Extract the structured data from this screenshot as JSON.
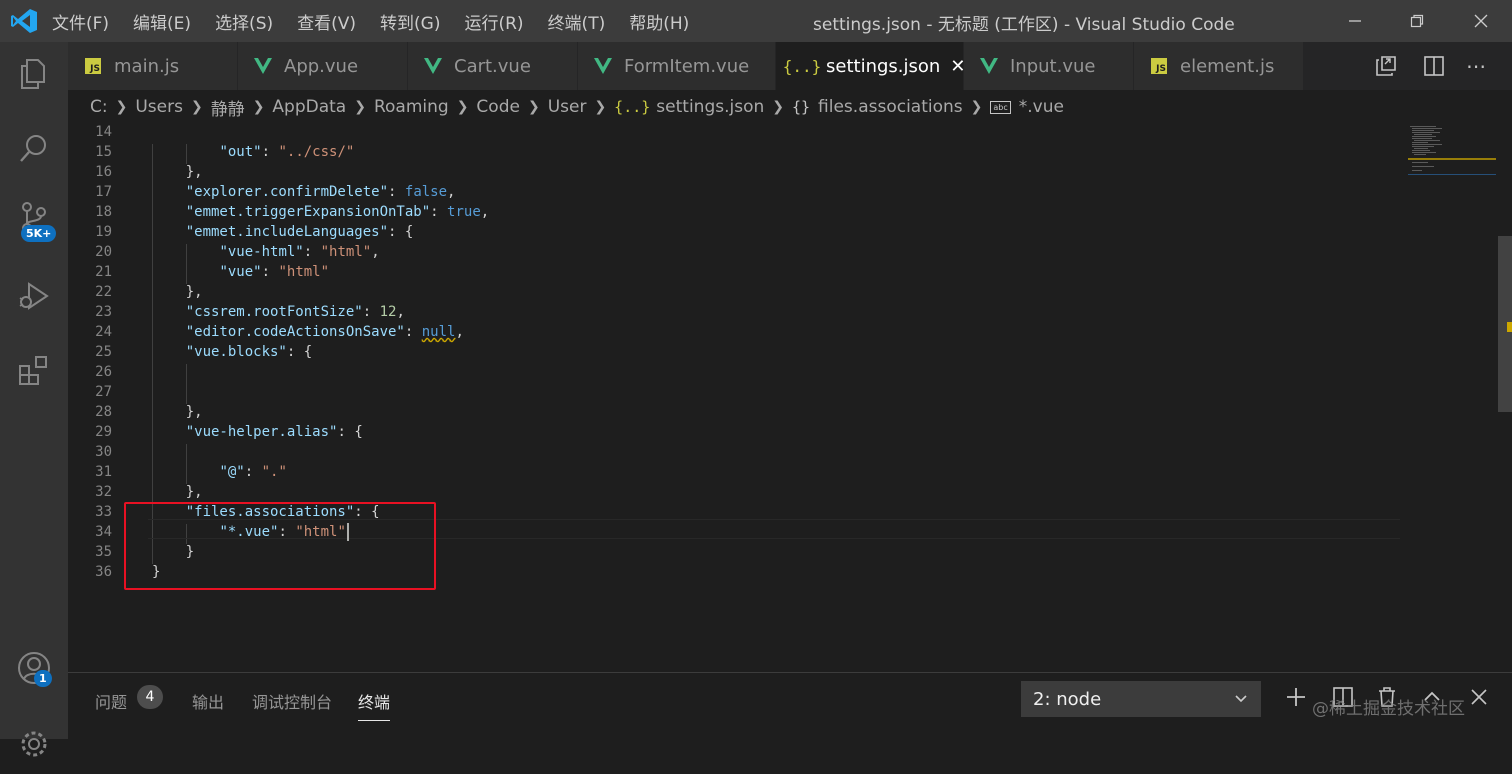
{
  "titlebar": {
    "menu": [
      "文件(F)",
      "编辑(E)",
      "选择(S)",
      "查看(V)",
      "转到(G)",
      "运行(R)",
      "终端(T)",
      "帮助(H)"
    ],
    "title": "settings.json - 无标题 (工作区) - Visual Studio Code"
  },
  "activitybar": {
    "items": [
      "explorer-icon",
      "search-icon",
      "source-control-icon",
      "run-debug-icon",
      "extensions-icon",
      "account-icon",
      "manage-icon"
    ],
    "scm_badge": "5K+",
    "account_badge": "1"
  },
  "tabs": [
    {
      "label": "main.js",
      "icon": "js"
    },
    {
      "label": "App.vue",
      "icon": "vue"
    },
    {
      "label": "Cart.vue",
      "icon": "vue"
    },
    {
      "label": "FormItem.vue",
      "icon": "vue"
    },
    {
      "label": "settings.json",
      "icon": "json",
      "active": true
    },
    {
      "label": "Input.vue",
      "icon": "vue"
    },
    {
      "label": "element.js",
      "icon": "js"
    }
  ],
  "breadcrumb": [
    "C:",
    "Users",
    "静静",
    "AppData",
    "Roaming",
    "Code",
    "User",
    "settings.json",
    "files.associations",
    "*.vue"
  ],
  "code_lines": [
    {
      "n": "14",
      "t": ""
    },
    {
      "n": "15",
      "t": "        \"out\": \"../css/\""
    },
    {
      "n": "16",
      "t": "    },"
    },
    {
      "n": "17",
      "t": "    \"explorer.confirmDelete\": false,"
    },
    {
      "n": "18",
      "t": "    \"emmet.triggerExpansionOnTab\": true,"
    },
    {
      "n": "19",
      "t": "    \"emmet.includeLanguages\": {"
    },
    {
      "n": "20",
      "t": "        \"vue-html\": \"html\","
    },
    {
      "n": "21",
      "t": "        \"vue\": \"html\""
    },
    {
      "n": "22",
      "t": "    },"
    },
    {
      "n": "23",
      "t": "    \"cssrem.rootFontSize\": 12,"
    },
    {
      "n": "24",
      "t": "    \"editor.codeActionsOnSave\": null,"
    },
    {
      "n": "25",
      "t": "    \"vue.blocks\": {"
    },
    {
      "n": "26",
      "t": ""
    },
    {
      "n": "27",
      "t": ""
    },
    {
      "n": "28",
      "t": "    },"
    },
    {
      "n": "29",
      "t": "    \"vue-helper.alias\": {"
    },
    {
      "n": "30",
      "t": ""
    },
    {
      "n": "31",
      "t": "        \"@\": \".\""
    },
    {
      "n": "32",
      "t": "    },"
    },
    {
      "n": "33",
      "t": "    \"files.associations\": {"
    },
    {
      "n": "34",
      "t": "        \"*.vue\": \"html\""
    },
    {
      "n": "35",
      "t": "    }"
    },
    {
      "n": "36",
      "t": "}"
    }
  ],
  "panel": {
    "tabs": [
      "问题",
      "输出",
      "调试控制台",
      "终端"
    ],
    "problems_count": "4",
    "terminal_select": "2: node",
    "watermark": "@稀土掘金技术社区"
  },
  "colors": {
    "titlebar": "#3c3c3c",
    "activitybar": "#333333",
    "editor_bg": "#1e1e1e",
    "accent_badge": "#0e70c0",
    "highlight_box": "#e81123"
  }
}
